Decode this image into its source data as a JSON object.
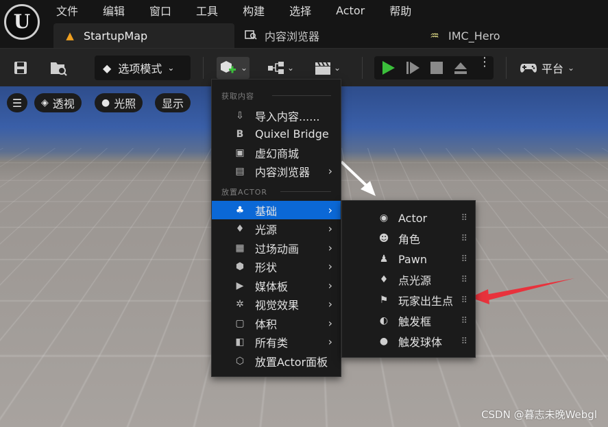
{
  "app": {
    "logo_text": "U"
  },
  "menubar": [
    "文件",
    "编辑",
    "窗口",
    "工具",
    "构建",
    "选择",
    "Actor",
    "帮助"
  ],
  "tabs": [
    {
      "label": "StartupMap",
      "icon": "level-icon",
      "active": true
    },
    {
      "label": "内容浏览器",
      "icon": "content-browser-icon",
      "active": false
    },
    {
      "label": "IMC_Hero",
      "icon": "input-mapping-icon",
      "active": false
    }
  ],
  "toolbar": {
    "mode_label": "选项模式",
    "platform_label": "平台"
  },
  "viewport": {
    "perspective_label": "透视",
    "lighting_label": "光照",
    "show_label": "显示"
  },
  "menu": {
    "section_get_content": "获取内容",
    "section_place_actor": "放置ACTOR",
    "get_items": [
      {
        "label": "导入内容......",
        "icon": "import-icon",
        "submenu": false
      },
      {
        "label": "Quixel Bridge",
        "icon": "bridge-icon",
        "submenu": false
      },
      {
        "label": "虚幻商城",
        "icon": "marketplace-icon",
        "submenu": false
      },
      {
        "label": "内容浏览器",
        "icon": "content-browser-icon",
        "submenu": true
      }
    ],
    "place_items": [
      {
        "label": "基础",
        "icon": "basic-icon",
        "submenu": true,
        "selected": true
      },
      {
        "label": "光源",
        "icon": "light-icon",
        "submenu": true
      },
      {
        "label": "过场动画",
        "icon": "cinematic-icon",
        "submenu": true
      },
      {
        "label": "形状",
        "icon": "shape-icon",
        "submenu": true
      },
      {
        "label": "媒体板",
        "icon": "media-icon",
        "submenu": true
      },
      {
        "label": "视觉效果",
        "icon": "vfx-icon",
        "submenu": true
      },
      {
        "label": "体积",
        "icon": "volume-icon",
        "submenu": true
      },
      {
        "label": "所有类",
        "icon": "all-classes-icon",
        "submenu": true
      },
      {
        "label": "放置Actor面板",
        "icon": "place-actor-panel-icon",
        "submenu": false
      }
    ]
  },
  "submenu_basic": [
    {
      "label": "Actor",
      "icon": "actor-icon"
    },
    {
      "label": "角色",
      "icon": "character-icon"
    },
    {
      "label": "Pawn",
      "icon": "pawn-icon"
    },
    {
      "label": "点光源",
      "icon": "point-light-icon"
    },
    {
      "label": "玩家出生点",
      "icon": "player-start-icon"
    },
    {
      "label": "触发框",
      "icon": "trigger-box-icon"
    },
    {
      "label": "触发球体",
      "icon": "trigger-sphere-icon"
    }
  ],
  "watermark": "CSDN @暮志未晚Webgl",
  "colors": {
    "selection": "#0b68d6",
    "play": "#3bbf3b",
    "annotation": "#e8323c"
  }
}
